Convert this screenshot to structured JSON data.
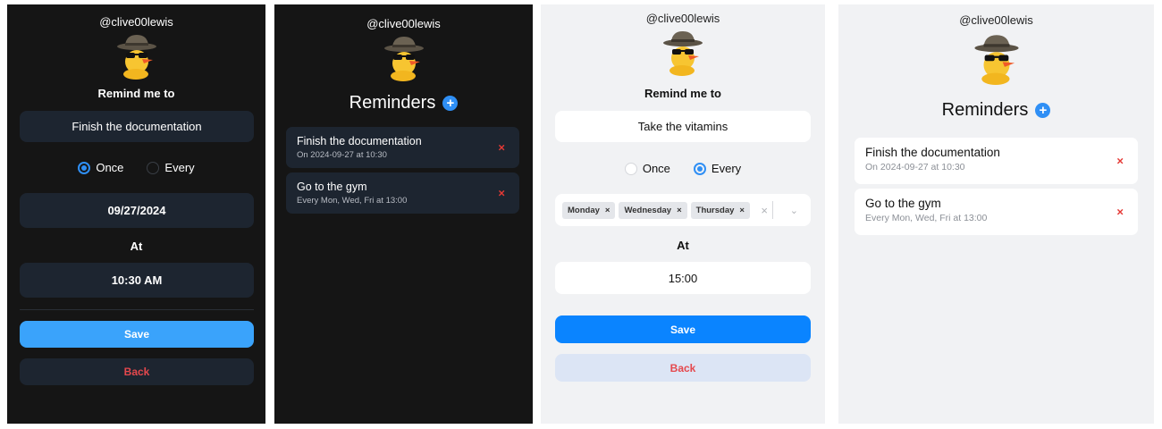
{
  "username": "@clive00lewis",
  "panel1": {
    "heading": "Remind me to",
    "task_value": "Finish the documentation",
    "once_label": "Once",
    "every_label": "Every",
    "date_value": "09/27/2024",
    "at_label": "At",
    "time_value": "10:30 AM",
    "save_label": "Save",
    "back_label": "Back"
  },
  "panel2": {
    "title": "Reminders",
    "plus": "+",
    "items": [
      {
        "title": "Finish the documentation",
        "subtitle": "On 2024-09-27 at 10:30",
        "delete": "×"
      },
      {
        "title": "Go to the gym",
        "subtitle": "Every Mon, Wed, Fri at 13:00",
        "delete": "×"
      }
    ]
  },
  "panel3": {
    "heading": "Remind me to",
    "task_value": "Take the vitamins",
    "once_label": "Once",
    "every_label": "Every",
    "days": [
      "Monday",
      "Wednesday",
      "Thursday"
    ],
    "tag_remove": "×",
    "clear": "×",
    "chevron": "⌄",
    "at_label": "At",
    "time_value": "15:00",
    "save_label": "Save",
    "back_label": "Back"
  },
  "panel4": {
    "title": "Reminders",
    "plus": "+",
    "items": [
      {
        "title": "Finish the documentation",
        "subtitle": "On 2024-09-27 at 10:30",
        "delete": "×"
      },
      {
        "title": "Go to the gym",
        "subtitle": "Every Mon, Wed, Fri at 13:00",
        "delete": "×"
      }
    ]
  },
  "colors": {
    "accent": "#2f8ff5",
    "danger": "#e53935",
    "dark_bg": "#151515",
    "light_bg": "#f1f2f4"
  }
}
